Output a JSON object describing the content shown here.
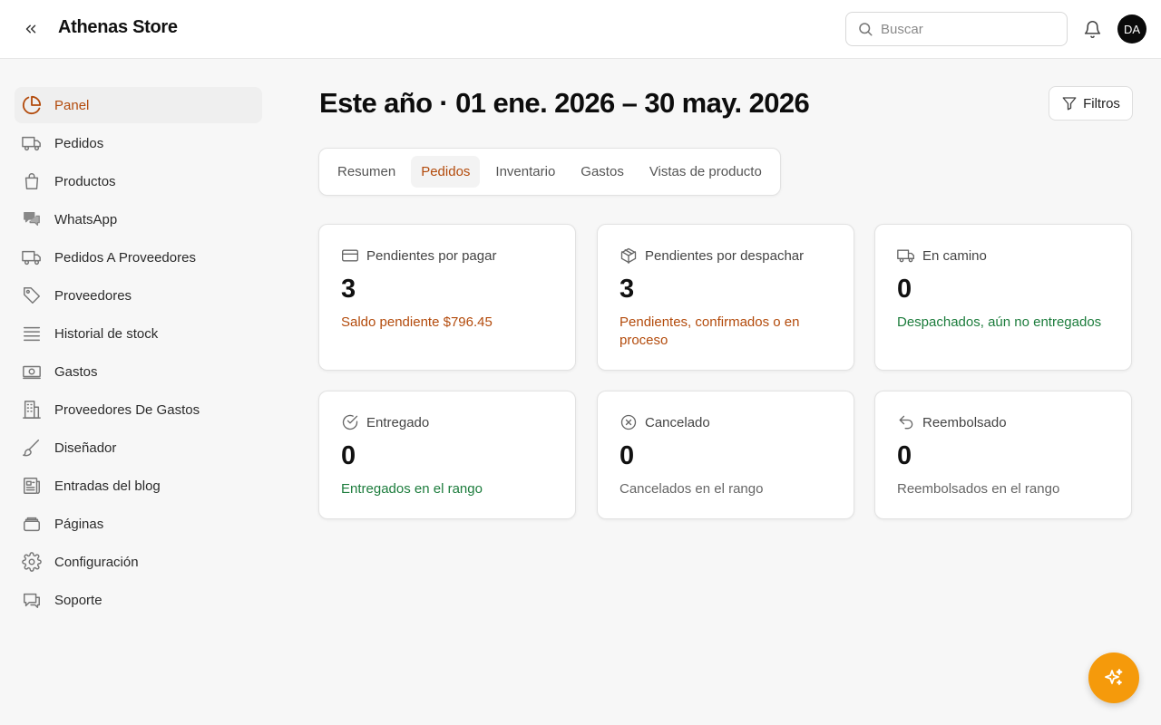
{
  "header": {
    "store_name": "Athenas Store",
    "search_placeholder": "Buscar",
    "avatar_initials": "DA"
  },
  "sidebar": {
    "items": [
      {
        "label": "Panel",
        "icon": "pie-chart-icon",
        "active": true
      },
      {
        "label": "Pedidos",
        "icon": "truck-icon"
      },
      {
        "label": "Productos",
        "icon": "shopping-bag-icon"
      },
      {
        "label": "WhatsApp",
        "icon": "chat-bubbles-icon"
      },
      {
        "label": "Pedidos A Proveedores",
        "icon": "truck-icon"
      },
      {
        "label": "Proveedores",
        "icon": "tag-icon"
      },
      {
        "label": "Historial de stock",
        "icon": "stack-icon"
      },
      {
        "label": "Gastos",
        "icon": "banknote-icon"
      },
      {
        "label": "Proveedores De Gastos",
        "icon": "building-icon"
      },
      {
        "label": "Diseñador",
        "icon": "paintbrush-icon"
      },
      {
        "label": "Entradas del blog",
        "icon": "newspaper-icon"
      },
      {
        "label": "Páginas",
        "icon": "pages-icon"
      },
      {
        "label": "Configuración",
        "icon": "gear-icon"
      },
      {
        "label": "Soporte",
        "icon": "support-chat-icon"
      }
    ]
  },
  "main": {
    "title": "Este año · 01 ene. 2026 – 30 may. 2026",
    "filters_label": "Filtros",
    "tabs": [
      {
        "label": "Resumen"
      },
      {
        "label": "Pedidos",
        "active": true
      },
      {
        "label": "Inventario"
      },
      {
        "label": "Gastos"
      },
      {
        "label": "Vistas de producto"
      }
    ],
    "cards": [
      {
        "title": "Pendientes por pagar",
        "value": "3",
        "sub": "Saldo pendiente $796.45",
        "icon": "credit-card-icon",
        "tone": "orange"
      },
      {
        "title": "Pendientes por despachar",
        "value": "3",
        "sub": "Pendientes, confirmados o en proceso",
        "icon": "package-icon",
        "tone": "orange"
      },
      {
        "title": "En camino",
        "value": "0",
        "sub": "Despachados, aún no entregados",
        "icon": "truck-icon",
        "tone": "green"
      },
      {
        "title": "Entregado",
        "value": "0",
        "sub": "Entregados en el rango",
        "icon": "check-circle-icon",
        "tone": "green"
      },
      {
        "title": "Cancelado",
        "value": "0",
        "sub": "Cancelados en el rango",
        "icon": "x-circle-icon",
        "tone": "gray"
      },
      {
        "title": "Reembolsado",
        "value": "0",
        "sub": "Reembolsados en el rango",
        "icon": "undo-icon",
        "tone": "gray"
      }
    ]
  },
  "colors": {
    "accent": "#b34b0c",
    "fab": "#f59a0b",
    "green": "#1c7c3c"
  }
}
